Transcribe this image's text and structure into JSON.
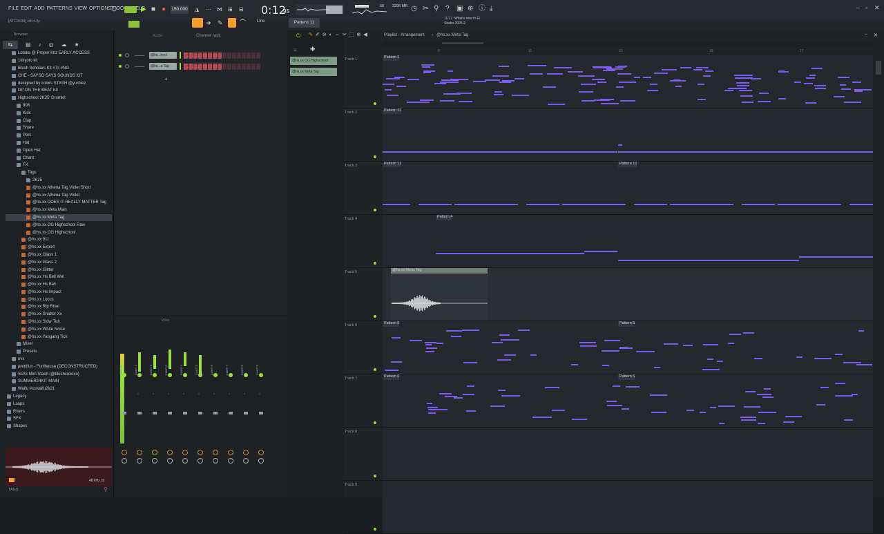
{
  "menu": [
    "FILE",
    "EDIT",
    "ADD",
    "PATTERNS",
    "VIEW",
    "OPTIONS",
    "TOOLS",
    "HELP"
  ],
  "transport": {
    "tempo": "150.000",
    "time": "0:12",
    "time_sub": "95",
    "cpu_mb": "3296 MB",
    "cpu_val": "58",
    "pattern": "Pattern 11",
    "snap": "Line",
    "hint_line1": "What's new in FL",
    "hint_line2": "Studio 2025.2",
    "hint_date": "11/27",
    "file_tag": "[ATC3699] stfc4.flp"
  },
  "browser": {
    "title": "Browser",
    "items": [
      {
        "label": "Lotaka @ Proper Kitz EARLY ACCESS",
        "type": "folder",
        "indent": 1
      },
      {
        "label": "1kkyoto kit",
        "type": "folder",
        "indent": 1
      },
      {
        "label": "Blush Scholars Kit  #7s #NG",
        "type": "folder",
        "indent": 1
      },
      {
        "label": "CHE - SAYSO SAYS SOUNDS KIT",
        "type": "folder",
        "indent": 1
      },
      {
        "label": "designed by colors STASH @yurbiez",
        "type": "folder",
        "indent": 1
      },
      {
        "label": "DP ON THE BEAT Kit",
        "type": "folder",
        "indent": 1
      },
      {
        "label": "Highschool 2K25' Drumkit",
        "type": "folder",
        "indent": 1
      },
      {
        "label": "808",
        "type": "folder",
        "indent": 2
      },
      {
        "label": "Kick",
        "type": "folder",
        "indent": 2
      },
      {
        "label": "Clap",
        "type": "folder",
        "indent": 2
      },
      {
        "label": "Snare",
        "type": "folder",
        "indent": 2
      },
      {
        "label": "Perc",
        "type": "folder",
        "indent": 2
      },
      {
        "label": "Hat",
        "type": "folder",
        "indent": 2
      },
      {
        "label": "Open Hat",
        "type": "folder",
        "indent": 2
      },
      {
        "label": "Chant",
        "type": "folder",
        "indent": 2
      },
      {
        "label": "FX",
        "type": "folder",
        "indent": 2
      },
      {
        "label": "Tags",
        "type": "folder",
        "indent": 3
      },
      {
        "label": "2K25",
        "type": "folder",
        "indent": 4
      },
      {
        "label": "@hs.xx Athena Tag Violet Short",
        "type": "file",
        "indent": 4
      },
      {
        "label": "@hs.xx Athena Tag Violet",
        "type": "file",
        "indent": 4
      },
      {
        "label": "@hs.xx DOES IT REALLY MATTER Tag",
        "type": "file",
        "indent": 4
      },
      {
        "label": "@hs.xx Meta Main",
        "type": "file",
        "indent": 4
      },
      {
        "label": "@hs.xx Meta Tag",
        "type": "file",
        "indent": 4,
        "selected": true
      },
      {
        "label": "@hs.xx OG Highschool Raw",
        "type": "file",
        "indent": 4
      },
      {
        "label": "@hs.xx OG Highschool",
        "type": "file",
        "indent": 4
      },
      {
        "label": "@hs.xx 911",
        "type": "file",
        "indent": 3
      },
      {
        "label": "@hs.xx Export",
        "type": "file",
        "indent": 3
      },
      {
        "label": "@hs.xx Glass 1",
        "type": "file",
        "indent": 3
      },
      {
        "label": "@hs.xx Glass 2",
        "type": "file",
        "indent": 3
      },
      {
        "label": "@hs.xx Glitter",
        "type": "file",
        "indent": 3
      },
      {
        "label": "@hs.xx Hs Bell Wet",
        "type": "file",
        "indent": 3
      },
      {
        "label": "@hs.xx Hs Bell",
        "type": "file",
        "indent": 3
      },
      {
        "label": "@hs.xx Hs Impact",
        "type": "file",
        "indent": 3
      },
      {
        "label": "@hs.xx Locus",
        "type": "file",
        "indent": 3
      },
      {
        "label": "@hs.xx Rip Riser",
        "type": "file",
        "indent": 3
      },
      {
        "label": "@hs.xx Shatter Xx",
        "type": "file",
        "indent": 3
      },
      {
        "label": "@hs.xx Slow Tick",
        "type": "file",
        "indent": 3
      },
      {
        "label": "@hs.xx White Noise",
        "type": "file",
        "indent": 3
      },
      {
        "label": "@hs.xx Yangang Tick",
        "type": "file",
        "indent": 3
      },
      {
        "label": "Mixer",
        "type": "folder",
        "indent": 2
      },
      {
        "label": "Presets",
        "type": "folder",
        "indent": 2
      },
      {
        "label": "nvx",
        "type": "folder",
        "indent": 1
      },
      {
        "label": "prettifun - Funlhouse (DECONSTRUCTED)",
        "type": "folder",
        "indent": 1
      },
      {
        "label": "SsXx Mini Stash (@blushxoxoxo)",
        "type": "folder",
        "indent": 1
      },
      {
        "label": "SUMMER24KIT MAIN",
        "type": "folder",
        "indent": 1
      },
      {
        "label": "Waifu #ccwaifu2k21",
        "type": "folder",
        "indent": 1
      },
      {
        "label": "Legacy",
        "type": "folder",
        "indent": 0
      },
      {
        "label": "Loops",
        "type": "folder",
        "indent": 0
      },
      {
        "label": "Risers",
        "type": "folder",
        "indent": 0
      },
      {
        "label": "SFX",
        "type": "folder",
        "indent": 0
      },
      {
        "label": "Shapes",
        "type": "folder",
        "indent": 0
      }
    ],
    "preview_info": "48 kHz 32",
    "footer": "TAGS"
  },
  "channel_rack": {
    "title": "Channel rack",
    "filter": "Audio",
    "channels": [
      {
        "name": "@hs...hool"
      },
      {
        "name": "@hs...a Tag"
      }
    ]
  },
  "mixer": {
    "title": "Wide",
    "tracks": [
      "Master",
      "Insert 1",
      "Insert 2",
      "Insert 3",
      "Insert 4",
      "Insert 5",
      "Insert 6",
      "Insert 7",
      "Insert 8",
      "Insert 9"
    ]
  },
  "pattern_list": [
    "@hs.xx OG Highschool",
    "@hs.xx Meta Tag"
  ],
  "playlist": {
    "title": "Playlist - Arrangement",
    "current": "@hs.xx Meta Tag",
    "ruler": [
      "9",
      "11",
      "13",
      "15",
      "17"
    ],
    "tracks": [
      {
        "name": "Track 1",
        "clips": [
          {
            "label": "Pattern 1"
          }
        ]
      },
      {
        "name": "Track 2",
        "clips": [
          {
            "label": "Pattern 11"
          }
        ]
      },
      {
        "name": "Track 3",
        "clips": [
          {
            "label": "Pattern 12"
          },
          {
            "label": "Pattern 12"
          }
        ]
      },
      {
        "name": "Track 4",
        "clips": [
          {
            "label": "Pattern 4"
          }
        ]
      },
      {
        "name": "Track 5",
        "clips": [
          {
            "label": "@hs.xx Meta Tag"
          }
        ]
      },
      {
        "name": "Track 6",
        "clips": [
          {
            "label": "Pattern 5"
          },
          {
            "label": "Pattern 5"
          }
        ]
      },
      {
        "name": "Track 7",
        "clips": [
          {
            "label": "Pattern 6"
          },
          {
            "label": "Pattern 6"
          }
        ]
      },
      {
        "name": "Track 8",
        "clips": []
      },
      {
        "name": "Track 9",
        "clips": []
      }
    ]
  },
  "colors": {
    "note": "#7b5bf0",
    "accent": "#f0a030",
    "meter": "#9be03c",
    "file_icon": "#c06838"
  }
}
